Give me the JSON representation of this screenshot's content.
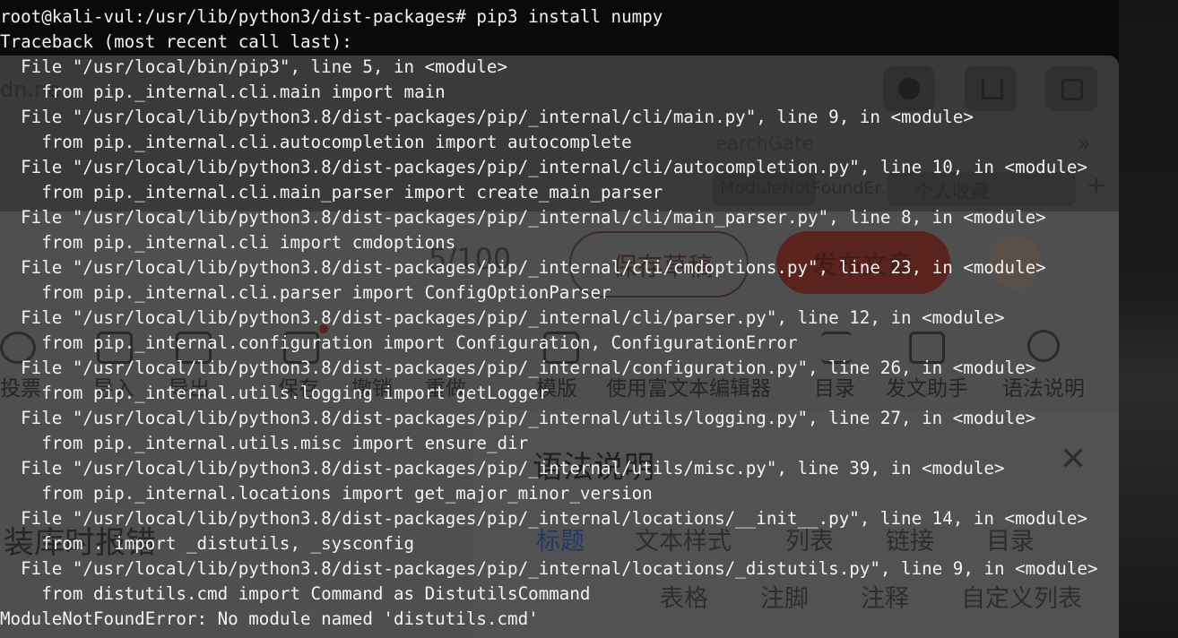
{
  "terminal": {
    "lines": [
      "root@kali-vul:/usr/lib/python3/dist-packages# pip3 install numpy",
      "Traceback (most recent call last):",
      "  File \"/usr/local/bin/pip3\", line 5, in <module>",
      "    from pip._internal.cli.main import main",
      "  File \"/usr/local/lib/python3.8/dist-packages/pip/_internal/cli/main.py\", line 9, in <module>",
      "    from pip._internal.cli.autocompletion import autocomplete",
      "  File \"/usr/local/lib/python3.8/dist-packages/pip/_internal/cli/autocompletion.py\", line 10, in <module>",
      "    from pip._internal.cli.main_parser import create_main_parser",
      "  File \"/usr/local/lib/python3.8/dist-packages/pip/_internal/cli/main_parser.py\", line 8, in <module>",
      "    from pip._internal.cli import cmdoptions",
      "  File \"/usr/local/lib/python3.8/dist-packages/pip/_internal/cli/cmdoptions.py\", line 23, in <module>",
      "    from pip._internal.cli.parser import ConfigOptionParser",
      "  File \"/usr/local/lib/python3.8/dist-packages/pip/_internal/cli/parser.py\", line 12, in <module>",
      "    from pip._internal.configuration import Configuration, ConfigurationError",
      "  File \"/usr/local/lib/python3.8/dist-packages/pip/_internal/configuration.py\", line 26, in <module>",
      "    from pip._internal.utils.logging import getLogger",
      "  File \"/usr/local/lib/python3.8/dist-packages/pip/_internal/utils/logging.py\", line 27, in <module>",
      "    from pip._internal.utils.misc import ensure_dir",
      "  File \"/usr/local/lib/python3.8/dist-packages/pip/_internal/utils/misc.py\", line 39, in <module>",
      "    from pip._internal.locations import get_major_minor_version",
      "  File \"/usr/local/lib/python3.8/dist-packages/pip/_internal/locations/__init__.py\", line 14, in <module>",
      "    from . import _distutils, _sysconfig",
      "  File \"/usr/local/lib/python3.8/dist-packages/pip/_internal/locations/_distutils.py\", line 9, in <module>",
      "    from distutils.cmd import Command as DistutilsCommand",
      "ModuleNotFoundError: No module named 'distutils.cmd'"
    ]
  },
  "background_window": {
    "url_fragment": "dn.ne",
    "bookmark_searchgate": "earchGate",
    "bookmark_error": "ModuleNotFoundEr...",
    "personal_favorites": "个人收藏",
    "word_count": "5/100",
    "save_draft": "保存草稿",
    "publish_article": "发布文章",
    "toolbar_labels": [
      "投票",
      "导入",
      "导出",
      "保存",
      "撤销",
      "重做",
      "模版",
      "使用富文本编辑器",
      "目录",
      "发文助手",
      "语法说明"
    ],
    "syntax_panel_title": "语法说明",
    "syntax_tabs_row1": [
      "标题",
      "文本样式",
      "列表",
      "链接",
      "目录"
    ],
    "syntax_tabs_row2": [
      "表格",
      "注脚",
      "注释",
      "自定义列表"
    ],
    "left_heading": "装库时报错"
  },
  "colors": {
    "terminal_text": "#f3f3f3",
    "terminal_background": "#0a0a0a",
    "publish_button": "#5a231d",
    "syntax_active_tab": "#1f3a66"
  }
}
